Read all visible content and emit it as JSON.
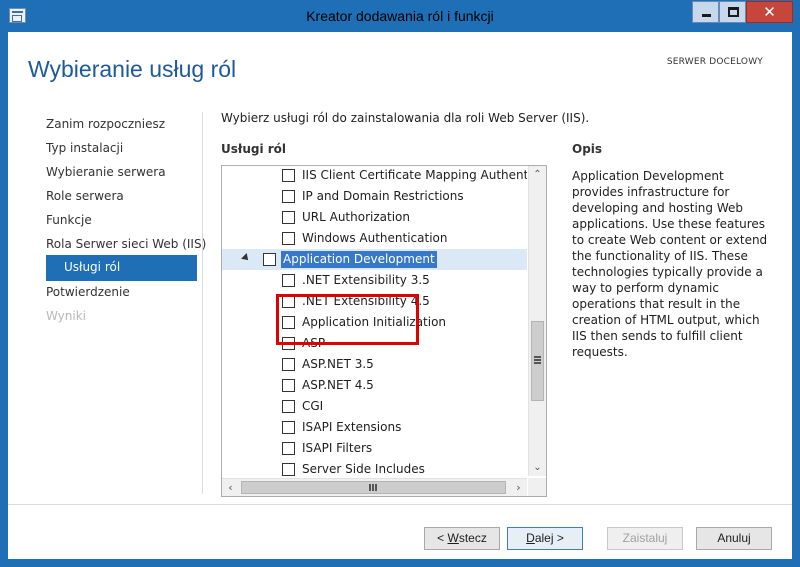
{
  "window": {
    "title": "Kreator dodawania ról i funkcji"
  },
  "header": {
    "page_title": "Wybieranie usług ról",
    "server_label": "SERWER DOCELOWY"
  },
  "nav": {
    "items": [
      {
        "label": "Zanim rozpoczniesz",
        "state": "normal"
      },
      {
        "label": "Typ instalacji",
        "state": "normal"
      },
      {
        "label": "Wybieranie serwera",
        "state": "normal"
      },
      {
        "label": "Role serwera",
        "state": "normal"
      },
      {
        "label": "Funkcje",
        "state": "normal"
      },
      {
        "label": "Rola Serwer sieci Web (IIS)",
        "state": "normal"
      },
      {
        "label": "Usługi ról",
        "state": "active"
      },
      {
        "label": "Potwierdzenie",
        "state": "normal"
      },
      {
        "label": "Wyniki",
        "state": "disabled"
      }
    ]
  },
  "main": {
    "intro": "Wybierz usługi ról do zainstalowania dla roli Web Server (IIS).",
    "services_label": "Usługi ról",
    "tree_items": [
      {
        "label": "IIS Client Certificate Mapping Authentication",
        "checked": false,
        "level": 2
      },
      {
        "label": "IP and Domain Restrictions",
        "checked": false,
        "level": 2
      },
      {
        "label": "URL Authorization",
        "checked": false,
        "level": 2
      },
      {
        "label": "Windows Authentication",
        "checked": false,
        "level": 2
      },
      {
        "label": "Application Development",
        "checked": false,
        "level": 1,
        "expanded": true,
        "selected": true
      },
      {
        "label": ".NET Extensibility 3.5",
        "checked": false,
        "level": 2
      },
      {
        "label": ".NET Extensibility 4.5",
        "checked": false,
        "level": 2
      },
      {
        "label": "Application Initialization",
        "checked": false,
        "level": 2
      },
      {
        "label": "ASP",
        "checked": false,
        "level": 2
      },
      {
        "label": "ASP.NET 3.5",
        "checked": false,
        "level": 2
      },
      {
        "label": "ASP.NET 4.5",
        "checked": false,
        "level": 2
      },
      {
        "label": "CGI",
        "checked": false,
        "level": 2
      },
      {
        "label": "ISAPI Extensions",
        "checked": false,
        "level": 2
      },
      {
        "label": "ISAPI Filters",
        "checked": false,
        "level": 2
      },
      {
        "label": "Server Side Includes",
        "checked": false,
        "level": 2
      }
    ]
  },
  "description": {
    "label": "Opis",
    "text": "Application Development provides infrastructure for developing and hosting Web applications. Use these features to create Web content or extend the functionality of IIS. These technologies typically provide a way to perform dynamic operations that result in the creation of HTML output, which IIS then sends to fulfill client requests."
  },
  "footer": {
    "back_label": "< Wstecz",
    "back_accesskey": "W",
    "back_rest": "stecz",
    "back_prefix": "< ",
    "next_accesskey": "D",
    "next_rest": "alej >",
    "install_accesskey": "n",
    "install_prefix": "Zai",
    "install_rest": "stal",
    "install_suffix": "uj",
    "install_label": "Zainstaluj",
    "cancel_label": "Anuluj"
  },
  "colors": {
    "accent": "#1e6fb5",
    "selection": "#3878c9",
    "annotation": "#e00000"
  },
  "icons": {
    "app": "wizard-app-icon",
    "minimize": "minimize-icon",
    "maximize": "maximize-icon",
    "close": "close-icon"
  }
}
